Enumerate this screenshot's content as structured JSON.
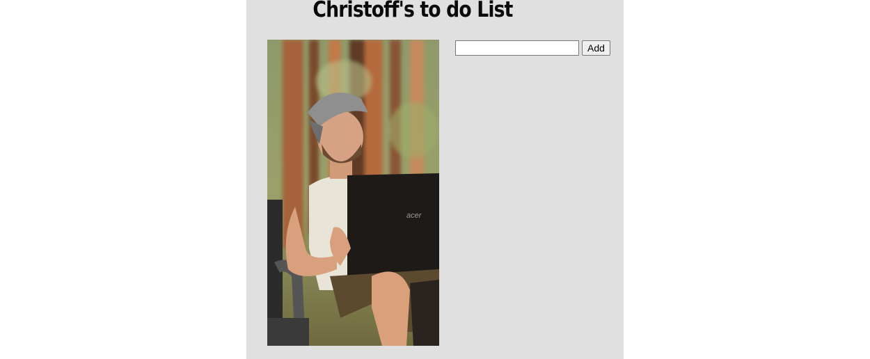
{
  "page": {
    "title": "Christoff's to do List"
  },
  "photo": {
    "alt": "Man in a cap sitting in a camp chair with a laptop in a forest",
    "laptop_brand": "acer"
  },
  "todo": {
    "input_value": "",
    "input_placeholder": "",
    "add_label": "Add"
  },
  "colors": {
    "panel_background": "#e0e0e0",
    "page_background": "#ffffff"
  }
}
